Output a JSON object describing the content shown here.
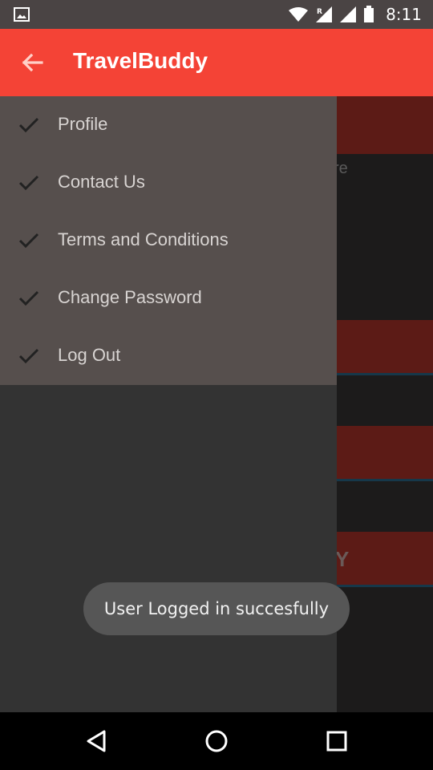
{
  "status_bar": {
    "time": "8:11",
    "icons": [
      "gallery-icon",
      "wifi-icon",
      "signal-roaming-icon",
      "signal-icon",
      "battery-icon"
    ]
  },
  "app_bar": {
    "title": "TravelBuddy",
    "back_icon": "arrow-back-icon",
    "color": "#f44336"
  },
  "drawer": {
    "items": [
      {
        "label": "Profile",
        "icon": "check-icon"
      },
      {
        "label": "Contact Us",
        "icon": "check-icon"
      },
      {
        "label": "Terms and Conditions",
        "icon": "check-icon"
      },
      {
        "label": "Change Password",
        "icon": "check-icon"
      },
      {
        "label": "Log Out",
        "icon": "check-icon"
      }
    ]
  },
  "background": {
    "partial_text_1": "re",
    "partial_text_2": "Y"
  },
  "toast": {
    "message": "User Logged in succesfully"
  },
  "nav_bar": {
    "icons": [
      "back-triangle-icon",
      "home-circle-icon",
      "recents-square-icon"
    ]
  }
}
